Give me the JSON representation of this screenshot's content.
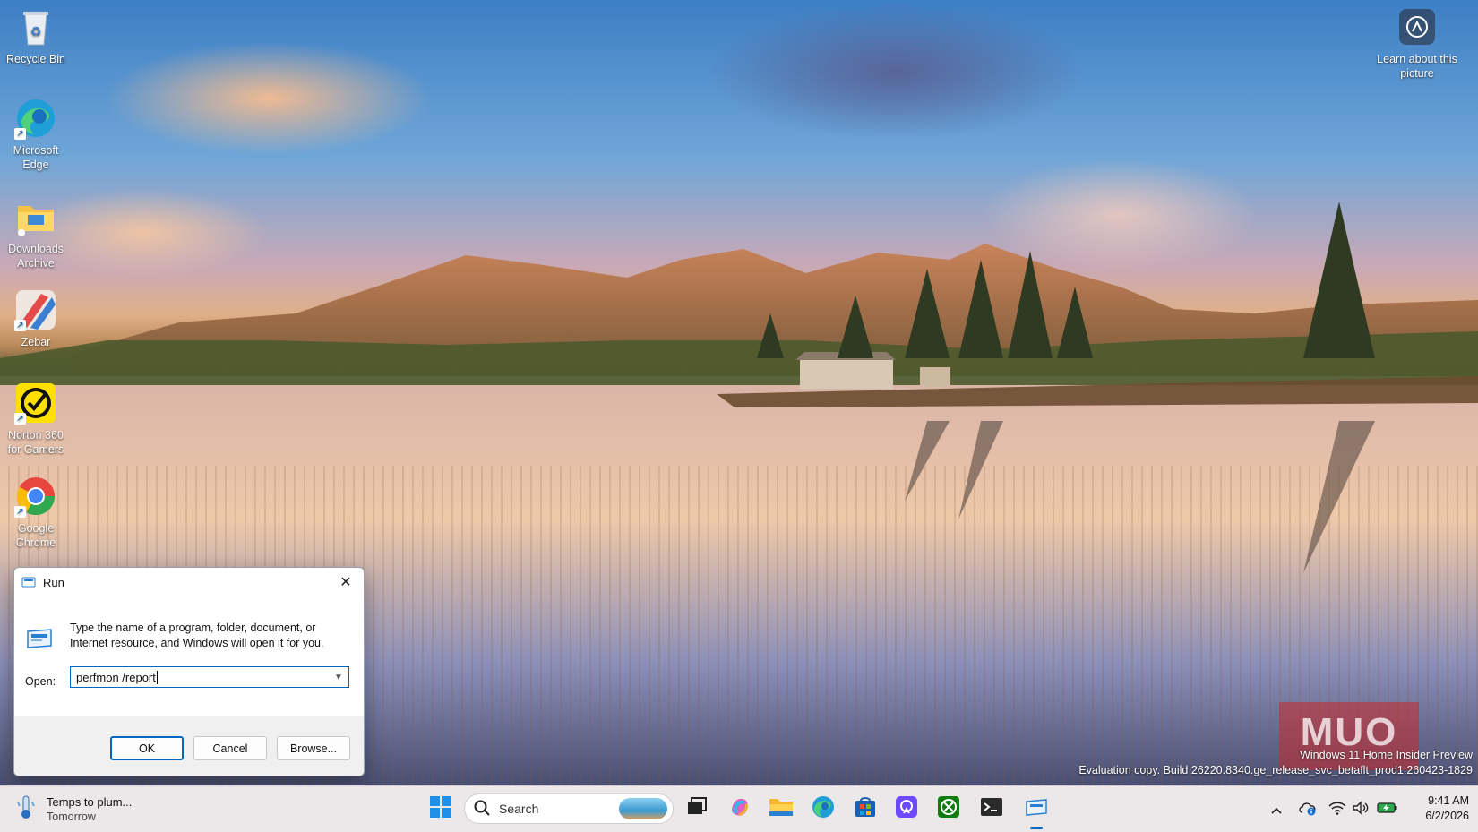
{
  "desktop": {
    "icons": [
      {
        "label": "Recycle Bin",
        "icon": "recycle-bin-icon"
      },
      {
        "label": "Microsoft Edge",
        "icon": "edge-icon"
      },
      {
        "label": "Downloads Archive",
        "icon": "folder-icon"
      },
      {
        "label": "Zebar",
        "icon": "zebar-icon"
      },
      {
        "label": "Norton 360 for Gamers",
        "icon": "norton-icon"
      },
      {
        "label": "Google Chrome",
        "icon": "chrome-icon"
      }
    ],
    "learn_label": "Learn about this picture",
    "watermark_line1": "Windows 11 Home Insider Preview",
    "watermark_line2": "Evaluation copy. Build 26220.8340.ge_release_svc_betaflt_prod1.260423-1829",
    "logo_text": "MUO"
  },
  "run_dialog": {
    "title": "Run",
    "description": "Type the name of a program, folder, document, or Internet resource, and Windows will open it for you.",
    "open_label": "Open:",
    "open_value": "perfmon /report",
    "ok_label": "OK",
    "cancel_label": "Cancel",
    "browse_label": "Browse..."
  },
  "taskbar": {
    "weather_title": "Temps to plum...",
    "weather_sub": "Tomorrow",
    "search_placeholder": "Search",
    "apps": [
      "start",
      "task-view",
      "copilot",
      "file-explorer",
      "edge",
      "microsoft-store",
      "proton-vpn",
      "xbox",
      "terminal",
      "run"
    ],
    "time": "9:41 AM",
    "date": "6/2/2026",
    "accent": "#0067c0"
  }
}
